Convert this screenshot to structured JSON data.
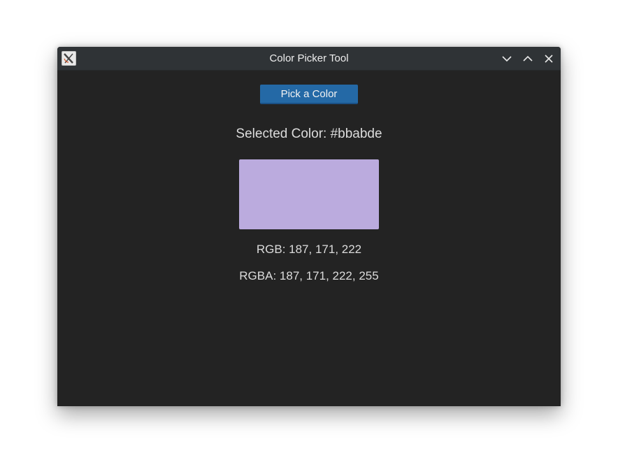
{
  "window": {
    "title": "Color Picker Tool",
    "app_icon": "x-app-icon",
    "controls": {
      "minimize_icon": "chevron-down-icon",
      "maximize_icon": "chevron-up-icon",
      "close_icon": "close-icon"
    }
  },
  "content": {
    "pick_button_label": "Pick a Color",
    "selected_color_text": "Selected Color: #bbabde",
    "swatch_color": "#bbabde",
    "rgb_text": "RGB: 187, 171, 222",
    "rgba_text": "RGBA: 187, 171, 222, 255"
  },
  "colors": {
    "window_bg": "#232323",
    "titlebar_bg": "#2f3336",
    "button_bg": "#2469a6",
    "text": "#dcdcdc"
  }
}
